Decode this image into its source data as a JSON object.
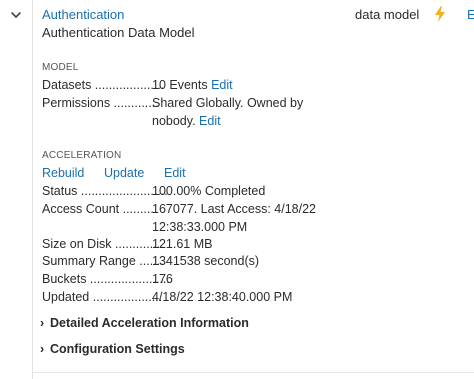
{
  "header": {
    "title_link": "Authentication",
    "subtitle": "Authentication Data Model",
    "type_text": "data model",
    "cut_link": "E",
    "bolt_color": "#f2b01e",
    "accent_color": "#1a6fb0"
  },
  "model": {
    "section_label": "MODEL",
    "datasets_label": "Datasets ....................",
    "datasets_value": "10 Events",
    "datasets_edit": "Edit",
    "permissions_label": "Permissions .............",
    "permissions_value_1": "Shared Globally. Owned by",
    "permissions_value_2": "nobody.",
    "permissions_edit": "Edit"
  },
  "acceleration": {
    "section_label": "ACCELERATION",
    "rebuild": "Rebuild",
    "update": "Update",
    "edit": "Edit",
    "rows": [
      {
        "label": "Status .........................",
        "value": "100.00% Completed"
      },
      {
        "label": "Access Count ..........",
        "value": "167077. Last Access: 4/18/22",
        "value2": "12:38:33.000 PM"
      },
      {
        "label": "Size on Disk ..............",
        "value": "121.61 MB"
      },
      {
        "label": "Summary Range .......",
        "value": "1341538 second(s)"
      },
      {
        "label": "Buckets .......................",
        "value": "176"
      },
      {
        "label": "Updated ....................",
        "value": "4/18/22 12:38:40.000 PM"
      }
    ]
  },
  "expanders": {
    "detailed": "Detailed Acceleration Information",
    "config": "Configuration Settings",
    "arrow": "›"
  }
}
